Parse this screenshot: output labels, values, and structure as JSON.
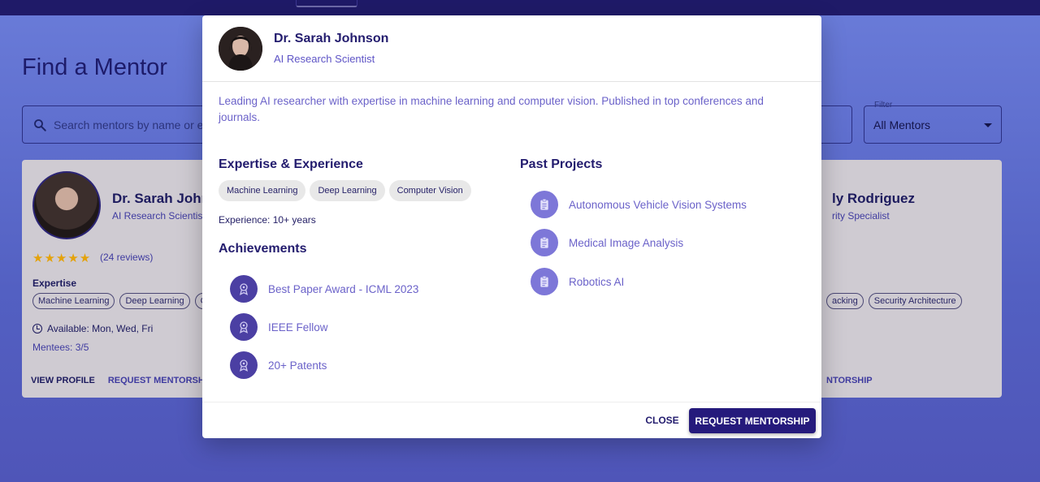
{
  "background": {
    "page_title": "Find a Mentor",
    "search_placeholder": "Search mentors by name or ex",
    "filter": {
      "label": "Filter",
      "value": "All Mentors"
    },
    "card_left": {
      "name": "Dr. Sarah John",
      "role": "AI Research Scientist",
      "stars": "★★★★★",
      "reviews": "(24 reviews)",
      "expertise_label": "Expertise",
      "chips": [
        "Machine Learning",
        "Deep Learning",
        "Co"
      ],
      "availability": "Available: Mon, Wed, Fri",
      "mentees": "Mentees: 3/5",
      "view_profile": "VIEW PROFILE",
      "request_mentorship": "REQUEST MENTORSHIP"
    },
    "card_right": {
      "name": "ly Rodriguez",
      "role": "rity Specialist",
      "chips": [
        "acking",
        "Security Architecture"
      ],
      "request_mentorship": "NTORSHIP"
    }
  },
  "modal": {
    "name": "Dr. Sarah Johnson",
    "role": "AI Research Scientist",
    "bio": "Leading AI researcher with expertise in machine learning and computer vision. Published in top conferences and journals.",
    "expertise_title": "Expertise & Experience",
    "expertise_chips": [
      "Machine Learning",
      "Deep Learning",
      "Computer Vision"
    ],
    "experience": "Experience: 10+ years",
    "achievements_title": "Achievements",
    "achievements": [
      "Best Paper Award - ICML 2023",
      "IEEE Fellow",
      "20+ Patents"
    ],
    "projects_title": "Past Projects",
    "projects": [
      "Autonomous Vehicle Vision Systems",
      "Medical Image Analysis",
      "Robotics AI"
    ],
    "close_button": "CLOSE",
    "request_button": "REQUEST MENTORSHIP"
  },
  "icons": {
    "achievement": "award-icon",
    "project": "clipboard-icon",
    "search": "search-icon",
    "clock": "clock-icon"
  },
  "colors": {
    "primary": "#251a7c",
    "accent_text": "#6b62c9",
    "achievement_icon_bg": "#4b3fa3",
    "project_icon_bg": "#7d77d8",
    "star": "#e4a20b"
  }
}
